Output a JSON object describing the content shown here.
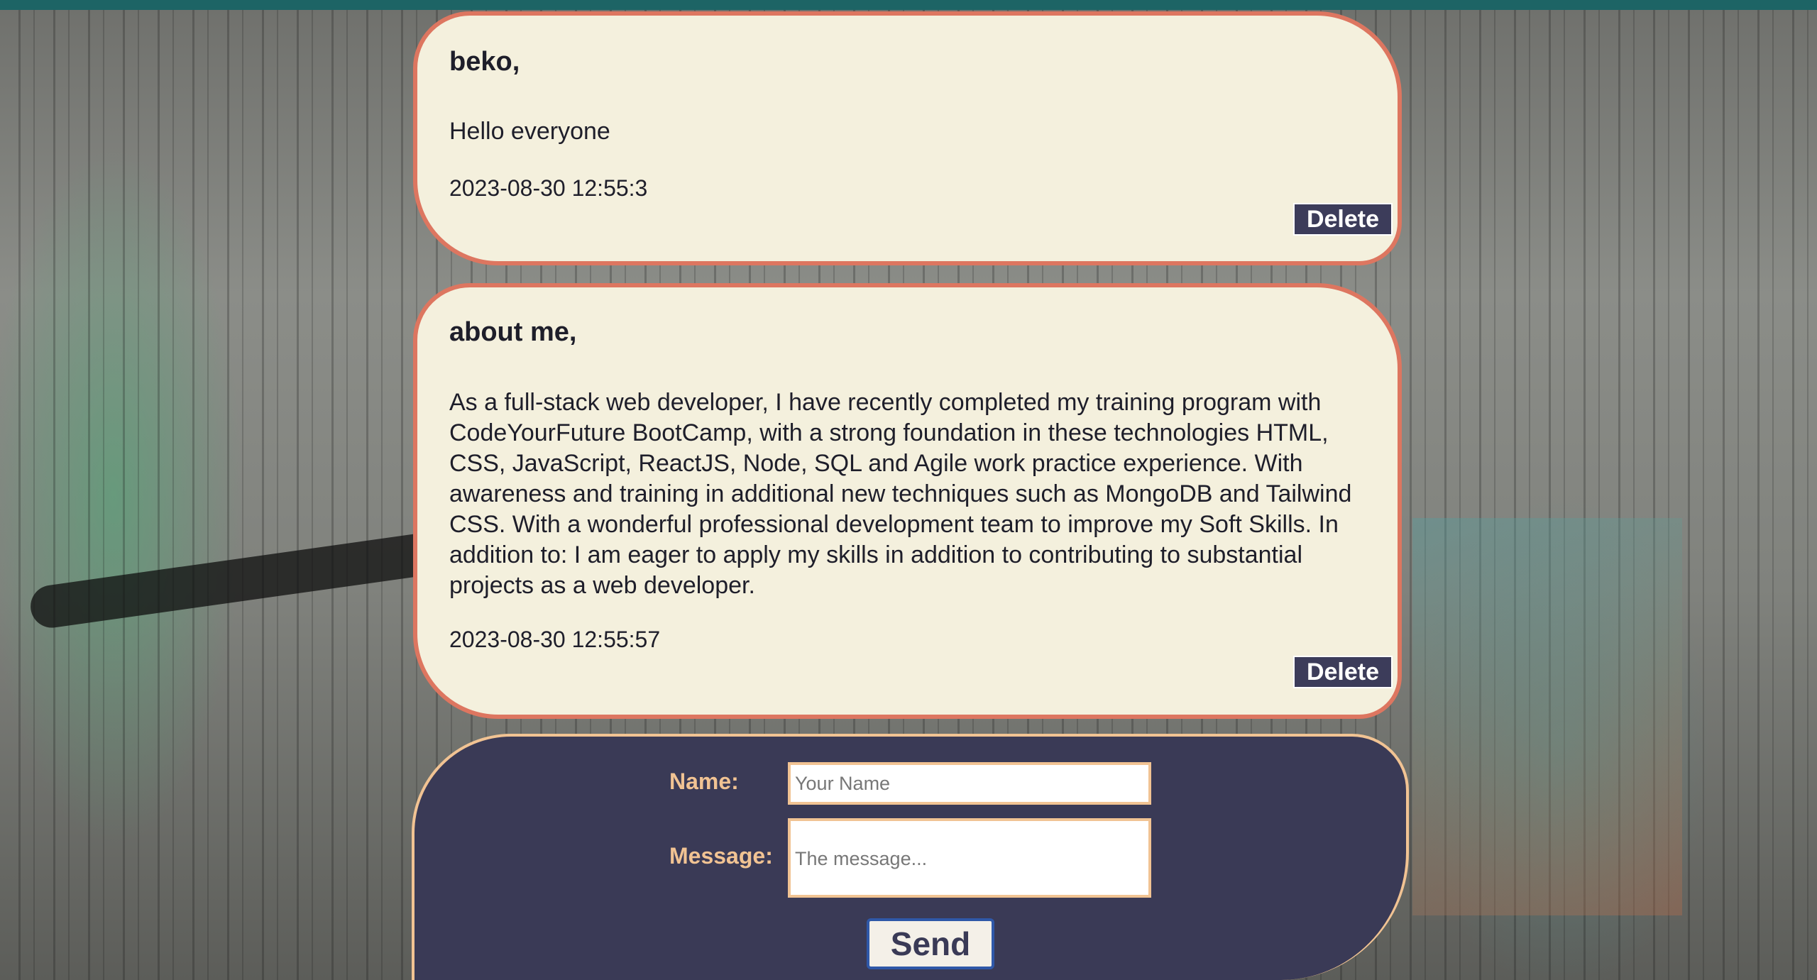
{
  "messages": [
    {
      "author": "beko,",
      "text": "Hello everyone",
      "timestamp": "2023-08-30 12:55:3",
      "delete_label": "Delete"
    },
    {
      "author": "about me,",
      "text": "As a full-stack web developer, I have recently completed my training program with CodeYourFuture BootCamp, with a strong foundation in these technologies HTML, CSS, JavaScript, ReactJS, Node, SQL and Agile work practice experience. With awareness and training in additional new techniques such as MongoDB and Tailwind CSS. With a wonderful professional development team to improve my Soft Skills. In addition to: I am eager to apply my skills in addition to contributing to substantial projects as a web developer.",
      "timestamp": "2023-08-30 12:55:57",
      "delete_label": "Delete"
    }
  ],
  "form": {
    "name_label": "Name:",
    "name_placeholder": "Your Name",
    "message_label": "Message:",
    "message_placeholder": "The message...",
    "send_label": "Send"
  },
  "colors": {
    "top_bar": "#1d6465",
    "card_background": "#f4f0dd",
    "card_border": "#dd7660",
    "form_background": "#3a3a56",
    "form_accent": "#f1c393",
    "delete_button": "#3c3c5a"
  }
}
